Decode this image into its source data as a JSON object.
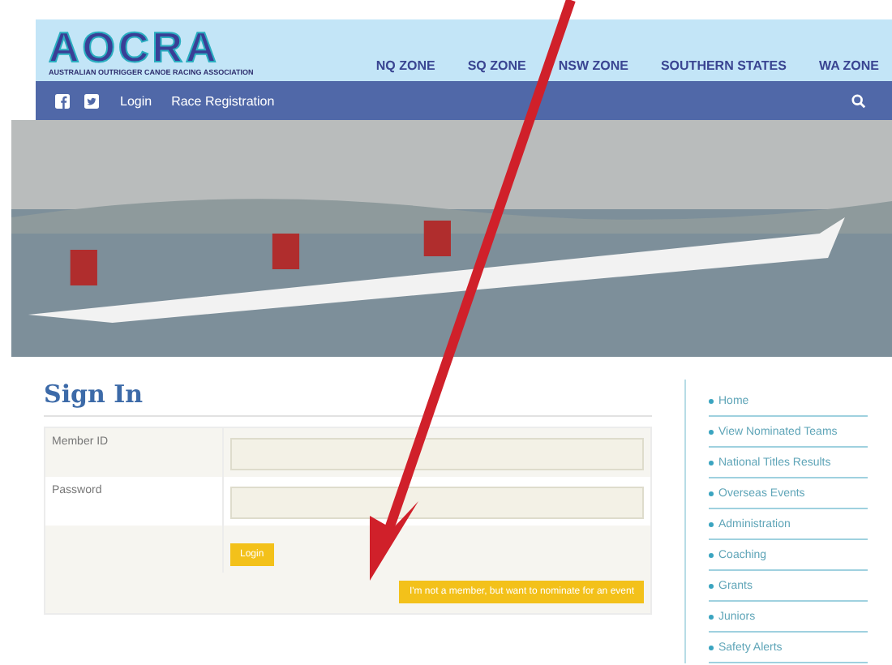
{
  "header": {
    "logo_text": "AOCRA",
    "logo_subtitle": "AUSTRALIAN OUTRIGGER CANOE RACING ASSOCIATION",
    "zones": [
      "NQ ZONE",
      "SQ ZONE",
      "NSW ZONE",
      "SOUTHERN STATES",
      "WA ZONE"
    ]
  },
  "toolbar": {
    "links": [
      "Login",
      "Race Registration"
    ]
  },
  "page_title": "Sign In",
  "form": {
    "fields": [
      {
        "label": "Member ID"
      },
      {
        "label": "Password"
      }
    ],
    "login_button": "Login",
    "nominate_button": "I'm not a member, but want to nominate for an event"
  },
  "sidebar": {
    "items": [
      "Home",
      "View Nominated Teams",
      "National Titles Results",
      "Overseas Events",
      "Administration",
      "Coaching",
      "Grants",
      "Juniors",
      "Safety Alerts"
    ]
  }
}
